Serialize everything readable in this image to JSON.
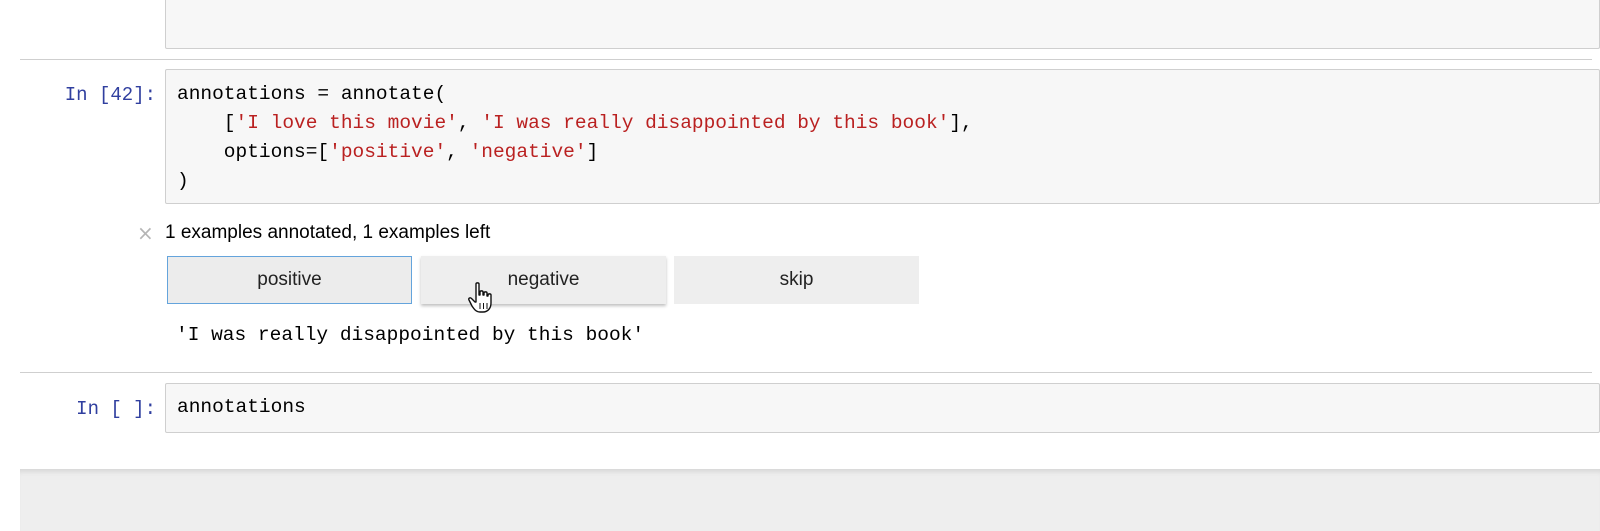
{
  "cells": [
    {
      "prompt": "In [42]:",
      "code": {
        "line1_a": "annotations = annotate(",
        "line2_indent": "    [",
        "line2_s1": "'I love this movie'",
        "line2_sep": ", ",
        "line2_s2": "'I was really disappointed by this book'",
        "line2_end": "],",
        "line3_a": "    options=[",
        "line3_s1": "'positive'",
        "line3_sep": ", ",
        "line3_s2": "'negative'",
        "line3_end": "]",
        "line4": ")"
      }
    },
    {
      "prompt": "In [ ]:",
      "code": "annotations"
    }
  ],
  "widget": {
    "close_symbol": "×",
    "status": "1 examples annotated, 1 examples left",
    "buttons": [
      "positive",
      "negative",
      "skip"
    ],
    "focused_button": "positive",
    "current_example": "'I was really disappointed by this book'"
  },
  "icons": {
    "close": "close-icon",
    "cursor": "hand-pointer-cursor-icon"
  },
  "colors": {
    "prompt": "#303f9f",
    "string": "#ba2121",
    "focus_border": "#64a4dc"
  }
}
